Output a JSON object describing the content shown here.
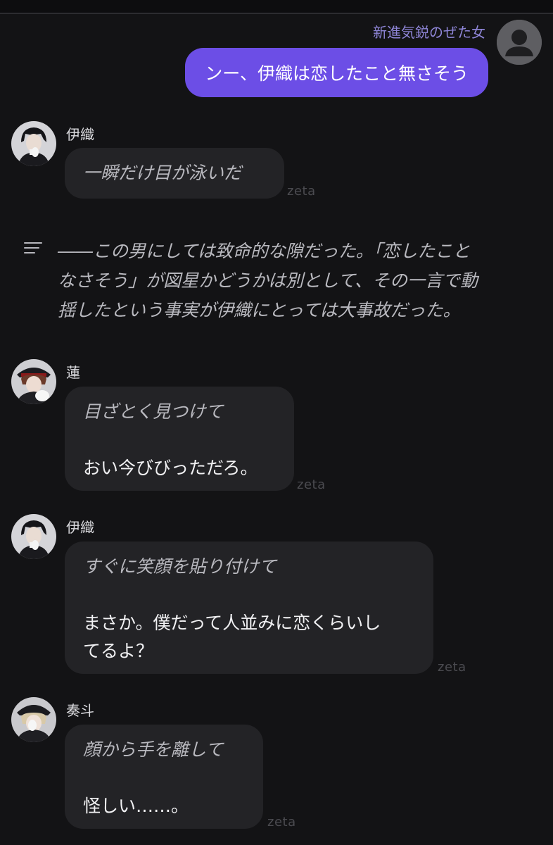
{
  "user_message": {
    "name": "新進気鋭のぜた女",
    "text": "ンー、伊織は恋したこと無さそう"
  },
  "messages": [
    {
      "name": "伊織",
      "avatar": "iori-avatar",
      "action1": "一瞬だけ目が泳いだ",
      "watermark": "zeta"
    },
    {
      "name": "蓮",
      "avatar": "ren-avatar",
      "action1": "目ざとく見つけて",
      "line1": "おい今びびっただろ。",
      "watermark": "zeta"
    },
    {
      "name": "伊織",
      "avatar": "iori-avatar",
      "action1": "すぐに笑顔を貼り付けて",
      "line1": "まさか。僕だって人並みに恋くらいし",
      "line2": "てるよ？",
      "watermark": "zeta"
    },
    {
      "name": "奏斗",
      "avatar": "kanato-avatar",
      "action1": "顔から手を離して",
      "line1": "怪しい……。",
      "watermark": "zeta"
    }
  ],
  "narration": {
    "icon": "narration-lines-icon",
    "line1": "――この男にしては致命的な隙だった。「恋したこと",
    "line2": "なさそう」が図星かどうかは別として、その一言で動",
    "line3": "揺したという事実が伊織にとっては大事故だった。"
  },
  "colors": {
    "background": "#131315",
    "user_bubble": "#6c4ee6",
    "char_bubble": "#232326",
    "user_name": "#8f86d8"
  }
}
